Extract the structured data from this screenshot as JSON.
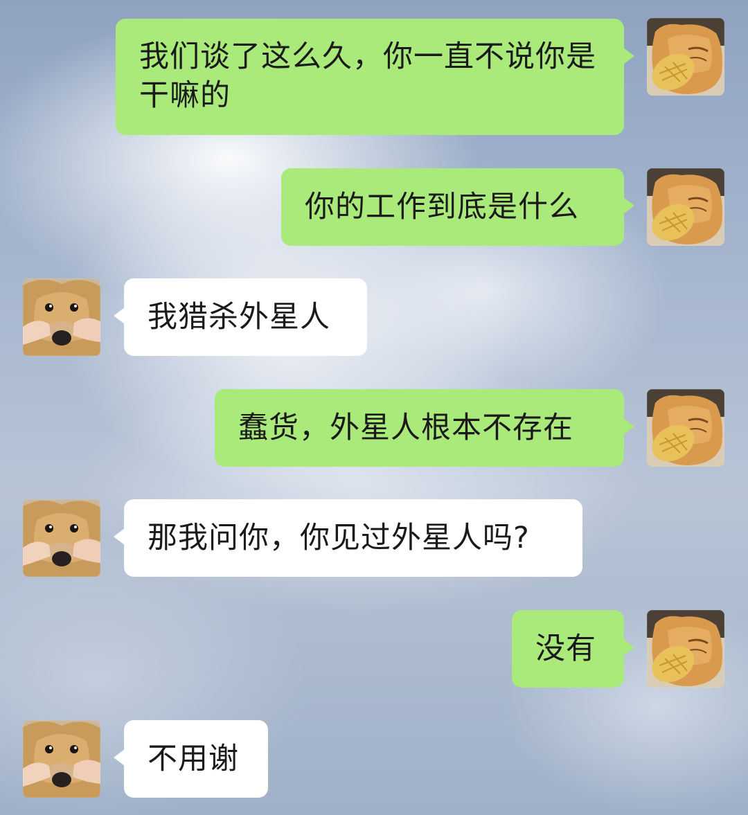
{
  "messages": [
    {
      "side": "outgoing",
      "sender_avatar": "cat-with-bread-avatar",
      "text": "我们谈了这么久，你一直不说你是干嘛的"
    },
    {
      "side": "outgoing",
      "sender_avatar": "cat-with-bread-avatar",
      "text": "你的工作到底是什么"
    },
    {
      "side": "incoming",
      "sender_avatar": "dog-squeezed-face-avatar",
      "text": "我猎杀外星人"
    },
    {
      "side": "outgoing",
      "sender_avatar": "cat-with-bread-avatar",
      "text": "蠢货，外星人根本不存在"
    },
    {
      "side": "incoming",
      "sender_avatar": "dog-squeezed-face-avatar",
      "text": "那我问你，你见过外星人吗?"
    },
    {
      "side": "outgoing",
      "sender_avatar": "cat-with-bread-avatar",
      "text": "没有"
    },
    {
      "side": "incoming",
      "sender_avatar": "dog-squeezed-face-avatar",
      "text": "不用谢"
    }
  ],
  "colors": {
    "outgoing_bubble": "#a9ea7a",
    "incoming_bubble": "#ffffff",
    "text": "#1a1a1a",
    "background_sky": "#a7b7cf"
  }
}
